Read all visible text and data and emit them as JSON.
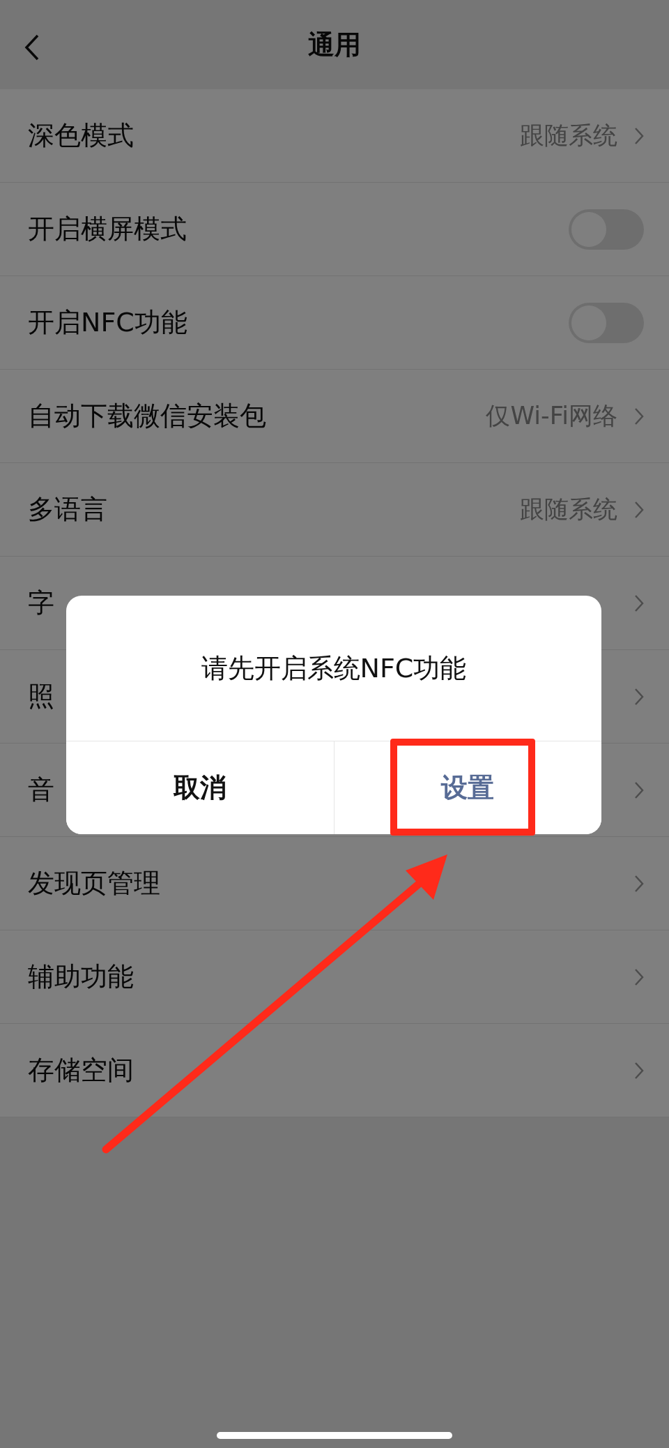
{
  "nav": {
    "title": "通用"
  },
  "settings": [
    {
      "kind": "link",
      "label": "深色模式",
      "value": "跟随系统"
    },
    {
      "kind": "toggle",
      "label": "开启横屏模式",
      "on": false
    },
    {
      "kind": "toggle",
      "label": "开启NFC功能",
      "on": false
    },
    {
      "kind": "link",
      "label": "自动下载微信安装包",
      "value": "仅Wi-Fi网络"
    },
    {
      "kind": "link",
      "label": "多语言",
      "value": "跟随系统"
    },
    {
      "kind": "link",
      "label": "字"
    },
    {
      "kind": "link",
      "label": "照"
    },
    {
      "kind": "link",
      "label": "音"
    },
    {
      "kind": "link",
      "label": "发现页管理"
    },
    {
      "kind": "link",
      "label": "辅助功能"
    },
    {
      "kind": "link",
      "label": "存储空间"
    }
  ],
  "dialog": {
    "message": "请先开启系统NFC功能",
    "buttons": [
      {
        "label": "取消",
        "kind": "cancel"
      },
      {
        "label": "设置",
        "kind": "primary"
      }
    ]
  }
}
